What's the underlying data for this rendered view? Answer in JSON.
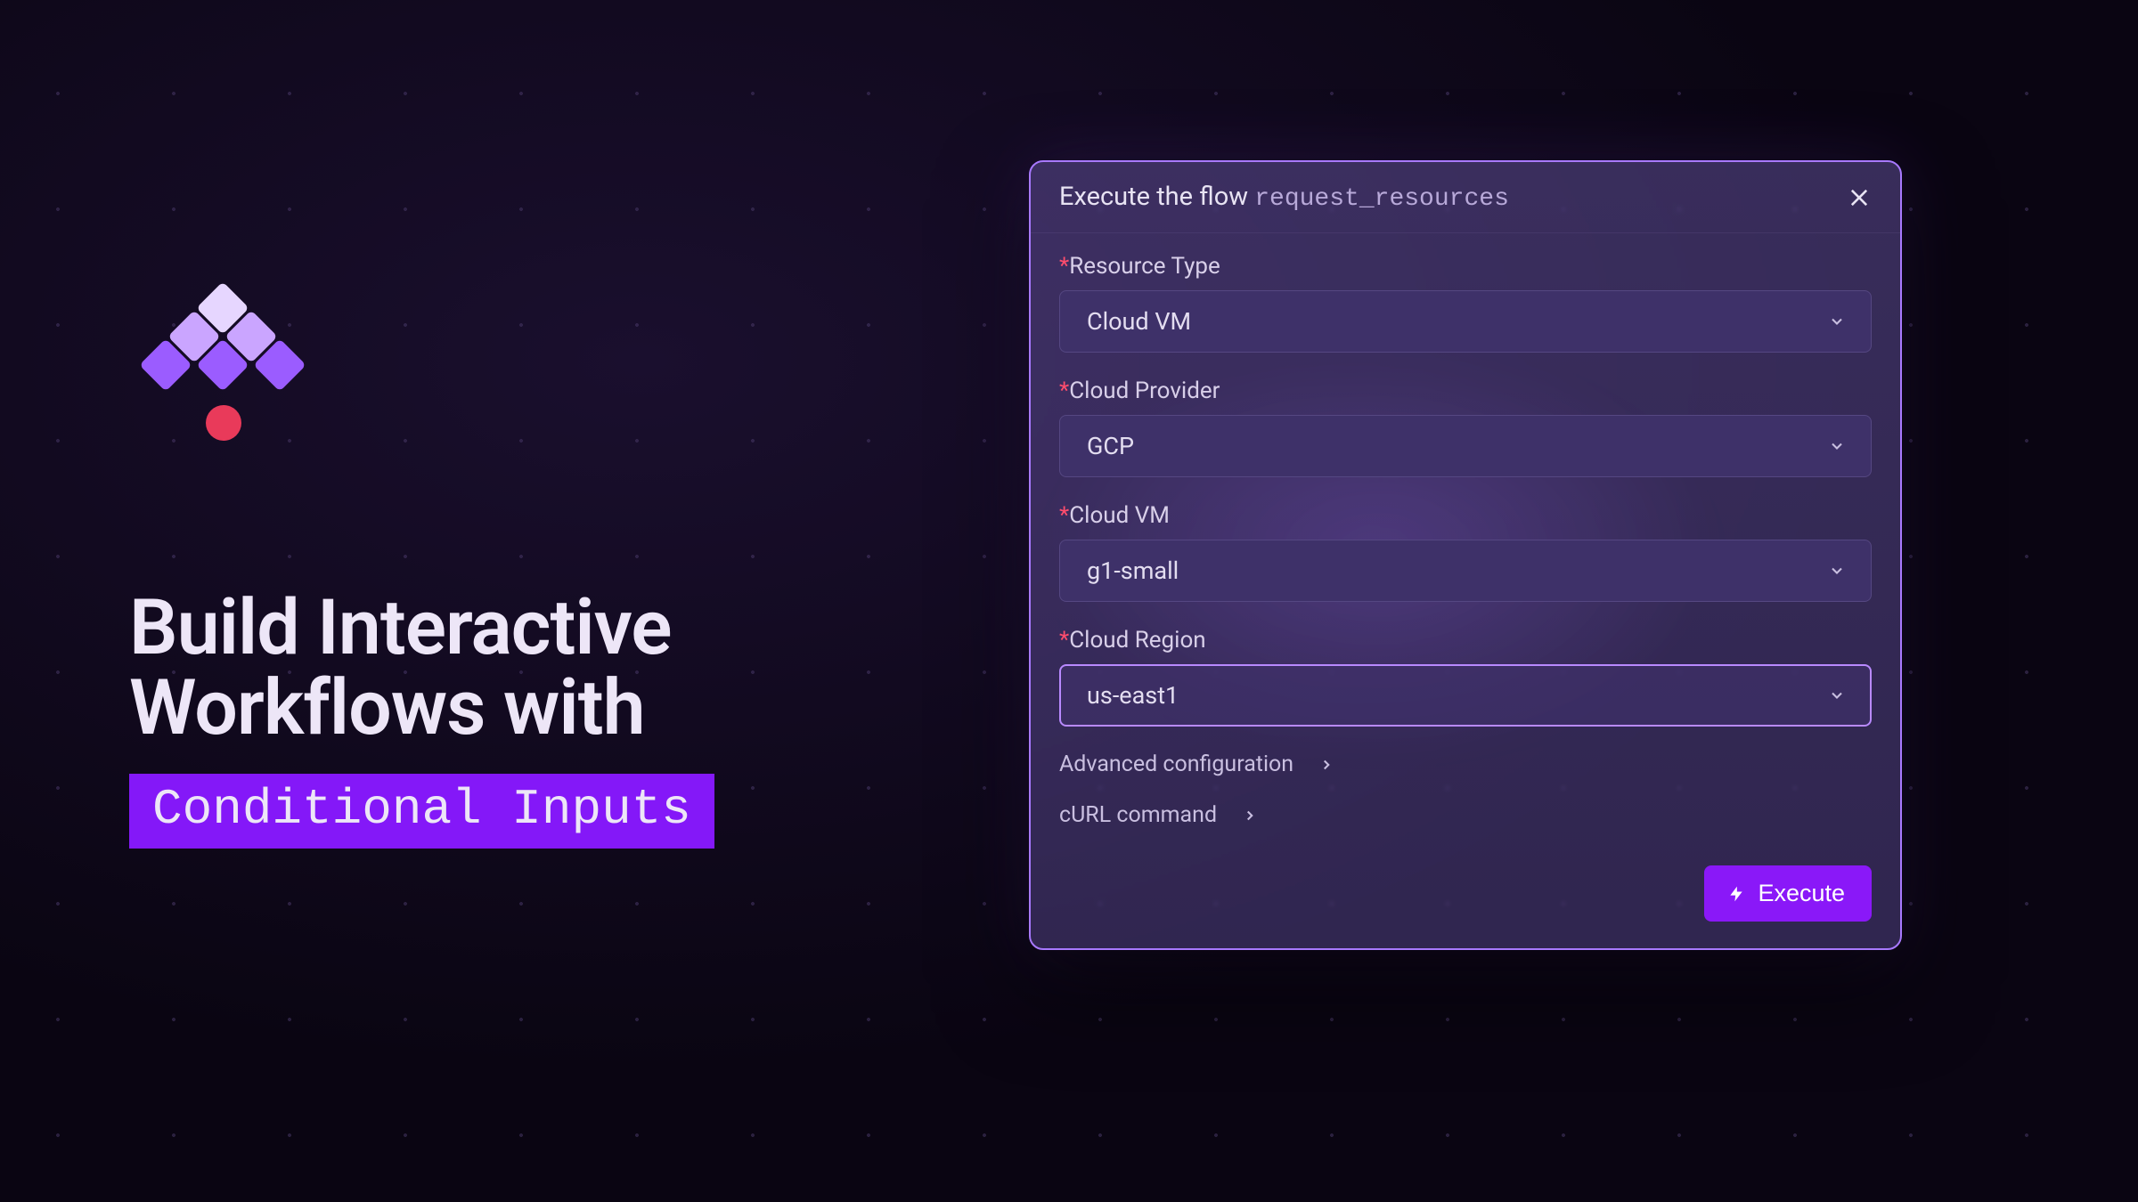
{
  "hero": {
    "line1": "Build Interactive",
    "line2": "Workflows with",
    "highlight": "Conditional Inputs"
  },
  "modal": {
    "title_prefix": "Execute the flow ",
    "title_flow": "request_resources",
    "fields": [
      {
        "label": "Resource Type",
        "required": true,
        "value": "Cloud VM",
        "focused": false
      },
      {
        "label": "Cloud Provider",
        "required": true,
        "value": "GCP",
        "focused": false
      },
      {
        "label": "Cloud VM",
        "required": true,
        "value": "g1-small",
        "focused": false
      },
      {
        "label": "Cloud Region",
        "required": true,
        "value": "us-east1",
        "focused": true
      }
    ],
    "advanced_label": "Advanced configuration",
    "curl_label": "cURL command",
    "execute_label": "Execute"
  },
  "colors": {
    "accent": "#8a18f8",
    "highlight_bg": "#8418f8",
    "border": "#a879ff"
  }
}
